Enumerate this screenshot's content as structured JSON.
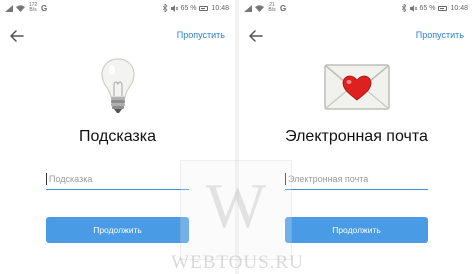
{
  "left_screen": {
    "status": {
      "speed_top": "172",
      "speed_bottom": "B/s",
      "network": "G",
      "battery": "65 %",
      "time": "10:48"
    },
    "skip_label": "Пропустить",
    "illustration_icon": "lightbulb-icon",
    "title": "Подсказка",
    "input_placeholder": "Подсказка",
    "input_value": "",
    "button_label": "Продолжить"
  },
  "right_screen": {
    "status": {
      "speed_top": "21",
      "speed_bottom": "B/s",
      "network": "G",
      "battery": "65 %",
      "time": "10:48"
    },
    "skip_label": "Пропустить",
    "illustration_icon": "love-letter-icon",
    "title": "Электронная почта",
    "input_placeholder": "Электронная почта",
    "input_value": "",
    "button_label": "Продолжить"
  },
  "watermark": {
    "mark": "W",
    "text": "WEBTOUS.RU"
  },
  "colors": {
    "accent": "#2a7fd4",
    "button": "#4a9be6",
    "underline": "#3b8fe0"
  }
}
